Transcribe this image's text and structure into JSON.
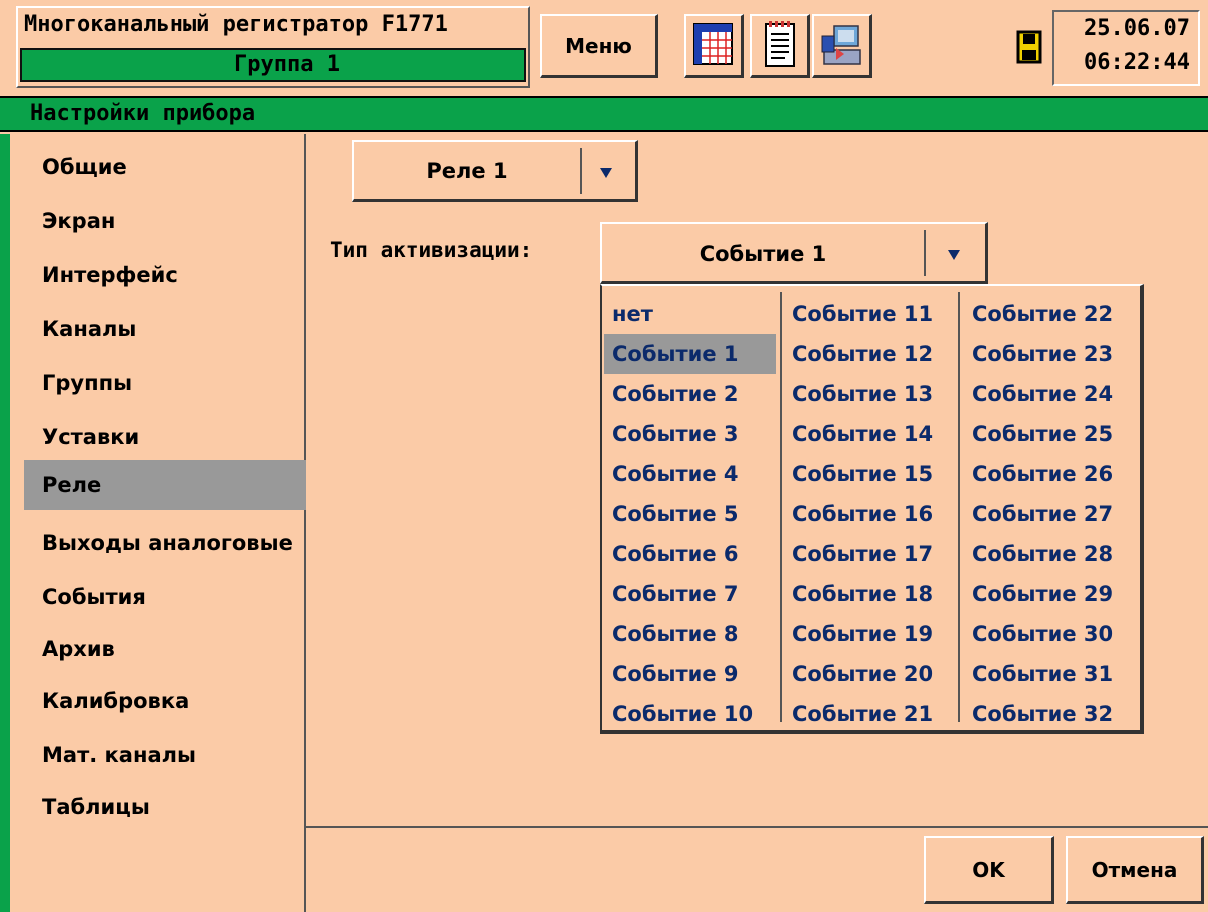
{
  "header": {
    "app_title": "Многоканальный регистратор F1771",
    "group": "Группа 1",
    "menu_label": "Меню",
    "date": "25.06.07",
    "time": "06:22:44"
  },
  "settings_title": "Настройки прибора",
  "sidebar": {
    "items": [
      {
        "label": "Общие"
      },
      {
        "label": "Экран"
      },
      {
        "label": "Интерфейс"
      },
      {
        "label": "Каналы"
      },
      {
        "label": "Группы"
      },
      {
        "label": "Уставки"
      },
      {
        "label": "Реле",
        "selected": true
      },
      {
        "label": "Выходы аналоговые"
      },
      {
        "label": "События"
      },
      {
        "label": "Архив"
      },
      {
        "label": "Калибровка"
      },
      {
        "label": "Мат. каналы"
      },
      {
        "label": "Таблицы"
      }
    ]
  },
  "relay_select": {
    "value": "Реле 1"
  },
  "activation": {
    "label": "Тип активизации:",
    "value": "Событие 1"
  },
  "event_list": {
    "col1": [
      "нет",
      "Событие 1",
      "Событие 2",
      "Событие 3",
      "Событие 4",
      "Событие 5",
      "Событие 6",
      "Событие 7",
      "Событие 8",
      "Событие 9",
      "Событие 10"
    ],
    "col2": [
      "Событие 11",
      "Событие 12",
      "Событие 13",
      "Событие 14",
      "Событие 15",
      "Событие 16",
      "Событие 17",
      "Событие 18",
      "Событие 19",
      "Событие 20",
      "Событие 21"
    ],
    "col3": [
      "Событие 22",
      "Событие 23",
      "Событие 24",
      "Событие 25",
      "Событие 26",
      "Событие 27",
      "Событие 28",
      "Событие 29",
      "Событие 30",
      "Событие 31",
      "Событие 32"
    ],
    "selected": "Событие 1"
  },
  "buttons": {
    "ok": "OK",
    "cancel": "Отмена"
  },
  "colors": {
    "background": "#fbcba7",
    "accent_green": "#0aa24a",
    "selection_gray": "#999999",
    "list_text": "#0b2a6b"
  },
  "icons": [
    "table-grid-icon",
    "notes-icon",
    "save-computer-icon",
    "sd-card-icon",
    "dropdown-arrow-icon"
  ]
}
